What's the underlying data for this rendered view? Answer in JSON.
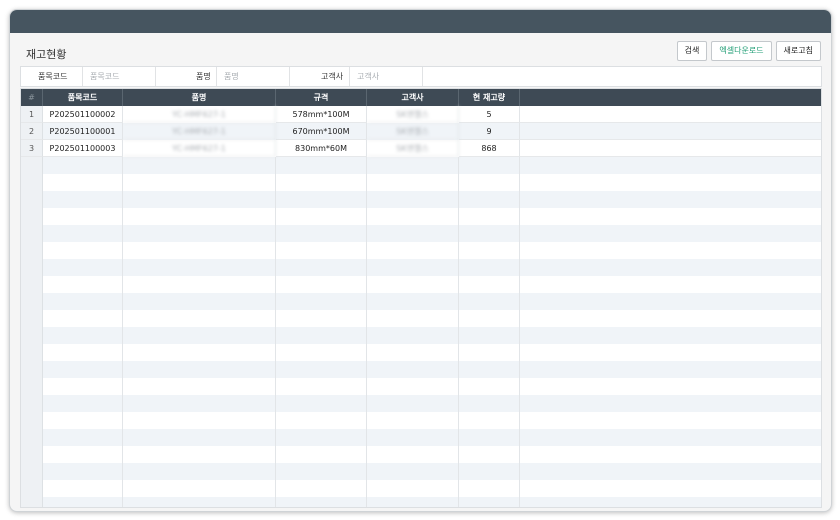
{
  "page": {
    "title": "재고현황"
  },
  "toolbar": {
    "search_label": "검색",
    "excel_label": "엑셀다운로드",
    "refresh_label": "새로고침"
  },
  "filters": {
    "item_code": {
      "label": "품목코드",
      "placeholder": "품목코드",
      "value": ""
    },
    "item_name": {
      "label": "품명",
      "placeholder": "품명",
      "value": ""
    },
    "customer": {
      "label": "고객사",
      "placeholder": "고객사",
      "value": ""
    }
  },
  "grid": {
    "columns": [
      "#",
      "품목코드",
      "품명",
      "규격",
      "고객사",
      "현 재고량"
    ],
    "rows": [
      {
        "no": "1",
        "code": "P202501100002",
        "name": "YC-HMF627-1",
        "spec": "578mm*100M",
        "customer": "SK엔젤스",
        "qty": "5"
      },
      {
        "no": "2",
        "code": "P202501100001",
        "name": "YC-HMF627-1",
        "spec": "670mm*100M",
        "customer": "SK엔젤스",
        "qty": "9"
      },
      {
        "no": "3",
        "code": "P202501100003",
        "name": "YC-HMF627-1",
        "spec": "830mm*60M",
        "customer": "SK엔젤스",
        "qty": "868"
      }
    ]
  },
  "colors": {
    "titlebar": "#465560",
    "grid_header": "#3e4a55",
    "excel_text": "#1f9d74",
    "alt_row": "#f0f4f8"
  }
}
